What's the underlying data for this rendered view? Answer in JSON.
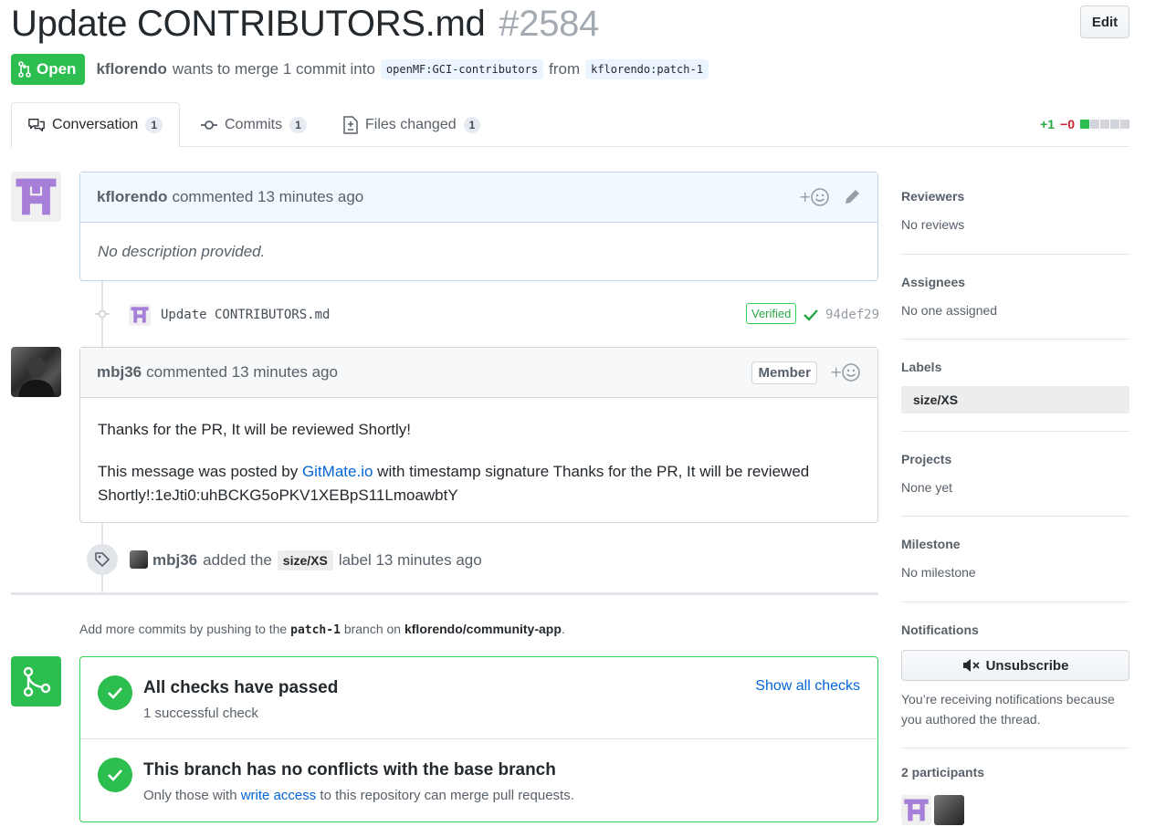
{
  "pr": {
    "title": "Update CONTRIBUTORS.md",
    "number": "#2584",
    "edit_label": "Edit",
    "state_label": "Open",
    "author": "kflorendo",
    "merge_text": "wants to merge 1 commit into",
    "base_branch": "openMF:GCI-contributors",
    "from_text": "from",
    "head_branch": "kflorendo:patch-1"
  },
  "tabs": [
    {
      "label": "Conversation",
      "count": "1"
    },
    {
      "label": "Commits",
      "count": "1"
    },
    {
      "label": "Files changed",
      "count": "1"
    }
  ],
  "diffstat": {
    "additions": "+1",
    "deletions": "−0"
  },
  "comment1": {
    "author": "kflorendo",
    "action": "commented 13 minutes ago",
    "body": "No description provided."
  },
  "commit": {
    "message": "Update CONTRIBUTORS.md",
    "verified": "Verified",
    "sha": "94def29"
  },
  "comment2": {
    "author": "mbj36",
    "action": "commented 13 minutes ago",
    "badge": "Member",
    "para1": "Thanks for the PR, It will be reviewed Shortly!",
    "para2_prefix": "This message was posted by",
    "para2_link": "GitMate.io",
    "para2_suffix": "with timestamp signature Thanks for the PR, It will be reviewed Shortly!:1eJti0:uhBCKG5oPKV1XEBpS11LmoawbtY"
  },
  "label_event": {
    "author": "mbj36",
    "text_before": "added the",
    "label": "size/XS",
    "text_after": "label 13 minutes ago"
  },
  "push_hint": {
    "prefix": "Add more commits by pushing to the",
    "branch": "patch-1",
    "middle": "branch on",
    "repo": "kflorendo/community-app",
    "suffix": "."
  },
  "merge": {
    "checks_title": "All checks have passed",
    "checks_sub": "1 successful check",
    "show_checks": "Show all checks",
    "conflict_title": "This branch has no conflicts with the base branch",
    "conflict_prefix": "Only those with",
    "conflict_link": "write access",
    "conflict_suffix": "to this repository can merge pull requests."
  },
  "sidebar": {
    "reviewers_h": "Reviewers",
    "reviewers_v": "No reviews",
    "assignees_h": "Assignees",
    "assignees_v": "No one assigned",
    "labels_h": "Labels",
    "label": "size/XS",
    "projects_h": "Projects",
    "projects_v": "None yet",
    "milestone_h": "Milestone",
    "milestone_v": "No milestone",
    "notifications_h": "Notifications",
    "unsubscribe": "Unsubscribe",
    "notif_reason": "You’re receiving notifications because you authored the thread.",
    "participants_h": "2 participants"
  },
  "colors": {
    "green": "#2cbe4e",
    "link": "#0366d6",
    "identicon": "#a77fd8"
  }
}
